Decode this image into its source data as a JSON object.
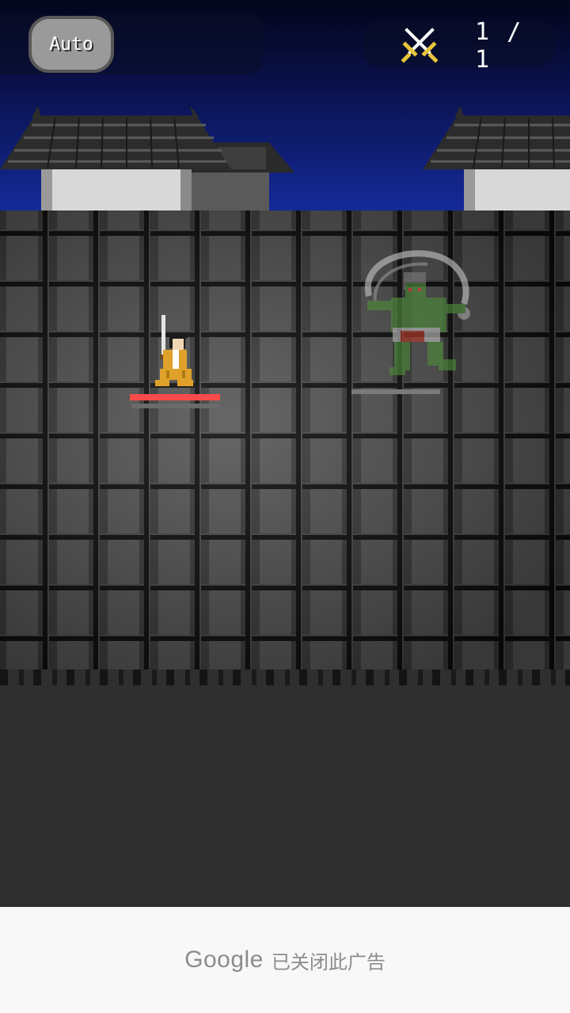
{
  "hud": {
    "auto_label": "Auto",
    "wave": "1 / 1",
    "icon": "crossed-swords-icon"
  },
  "player": {
    "hp_fraction": 1.0
  },
  "enemy": {
    "name_icon": "oni-demon-icon",
    "hp_fraction": 1.0
  },
  "ad": {
    "brand": "Google",
    "message": "已关闭此广告"
  },
  "colors": {
    "sky_top": "#03051a",
    "sky_bottom": "#142a9a",
    "hp_red": "#ff4a4a",
    "ground": "#2f2f2f",
    "ad_bg": "#f8f8f8"
  }
}
